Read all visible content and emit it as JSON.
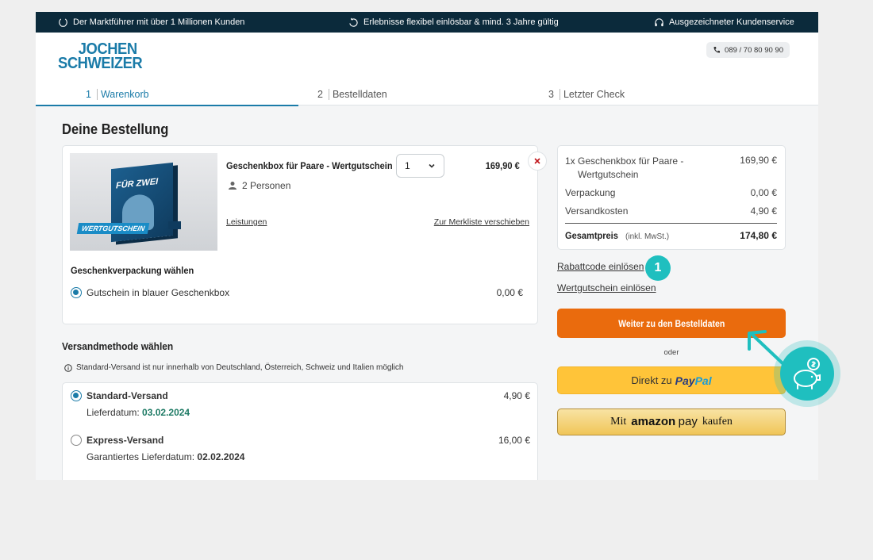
{
  "topbar": {
    "item1": "Der Marktführer mit über 1 Millionen Kunden",
    "item2": "Erlebnisse flexibel einlösbar & mind. 3 Jahre gültig",
    "item3": "Ausgezeichneter Kundenservice"
  },
  "header": {
    "logo_line1": "JOCHEN",
    "logo_line2": "SCHWEIZER",
    "phone": "089 / 70 80 90 90"
  },
  "steps": [
    {
      "num": "1",
      "label": "Warenkorb",
      "active": true
    },
    {
      "num": "2",
      "label": "Bestelldaten",
      "active": false
    },
    {
      "num": "3",
      "label": "Letzter Check",
      "active": false
    }
  ],
  "page_title": "Deine Bestellung",
  "product": {
    "image_text_top": "FÜR ZWEI",
    "image_banner": "WERTGUTSCHEIN",
    "title": "Geschenkbox für Paare - Wertgutschein",
    "persons": "2 Personen",
    "quantity": "1",
    "price": "169,90 €",
    "link_services": "Leistungen",
    "link_wishlist": "Zur Merkliste verschieben"
  },
  "gift_wrap": {
    "title": "Geschenkverpackung wählen",
    "option_label": "Gutschein in blauer Geschenkbox",
    "option_price": "0,00 €"
  },
  "shipping": {
    "title": "Versandmethode wählen",
    "info": "Standard-Versand ist nur innerhalb von Deutschland, Österreich, Schweiz und Italien möglich",
    "standard": {
      "name": "Standard-Versand",
      "price": "4,90 €",
      "date_label": "Lieferdatum:",
      "date": "03.02.2024"
    },
    "express": {
      "name": "Express-Versand",
      "price": "16,00 €",
      "date_label": "Garantiertes Lieferdatum:",
      "date": "02.02.2024"
    }
  },
  "summary": {
    "item_line1": "1x Geschenkbox für Paare -",
    "item_line2": "Wertgutschein",
    "item_price": "169,90 €",
    "packaging_label": "Verpackung",
    "packaging_price": "0,00 €",
    "shipping_label": "Versandkosten",
    "shipping_price": "4,90 €",
    "total_label": "Gesamtpreis",
    "total_note": "(inkl. MwSt.)",
    "total_price": "174,80 €"
  },
  "links": {
    "discount": "Rabattcode einlösen",
    "voucher": "Wertgutschein einlösen"
  },
  "badge": "1",
  "buttons": {
    "continue": "Weiter zu den Bestelldaten",
    "or": "oder",
    "paypal_prefix": "Direkt zu",
    "paypal_brand1": "Pay",
    "paypal_brand2": "Pal",
    "amazon_prefix": "Mit",
    "amazon_brand": "amazon",
    "amazon_pay": "pay",
    "amazon_suffix": "kaufen"
  },
  "colors": {
    "accent": "#1a7ba8",
    "topbar": "#0b2a3b",
    "orange": "#ea6b0d",
    "teal": "#1fbfbf",
    "paypal_yellow": "#ffc439"
  }
}
